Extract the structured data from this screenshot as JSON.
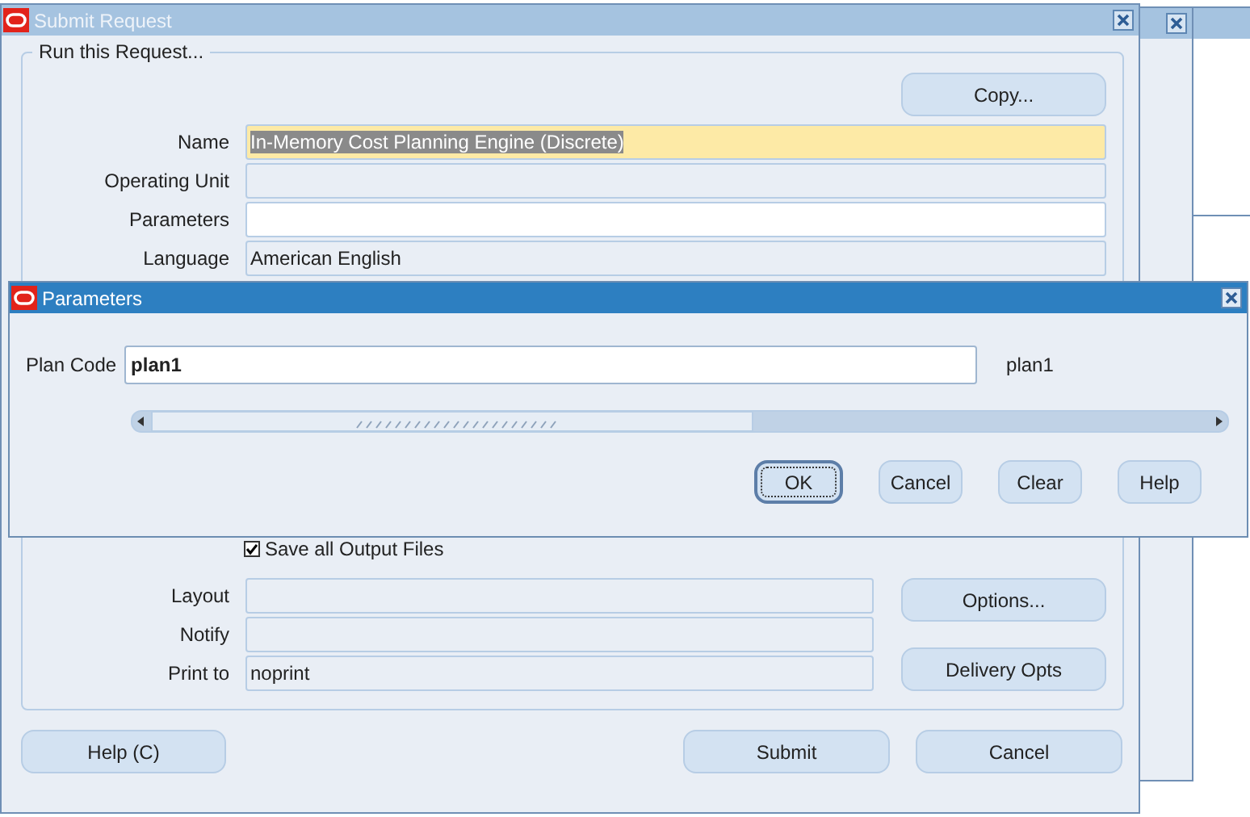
{
  "window": {
    "title": "Submit Request",
    "active": false
  },
  "group": {
    "title": "Run this Request..."
  },
  "copy_button": {
    "label": "Copy..."
  },
  "fields": [
    {
      "label": "Name",
      "value": "In-Memory Cost Planning Engine (Discrete)",
      "kind": "selected"
    },
    {
      "label": "Operating Unit",
      "kind": "readonly"
    },
    {
      "label": "Parameters",
      "kind": "editable"
    },
    {
      "label": "Language",
      "value": "American English",
      "kind": "readonly"
    }
  ],
  "save_output": {
    "label": "Save all Output Files",
    "checked": true
  },
  "delivery_fields": [
    {
      "label": "Layout",
      "kind": "readonly"
    },
    {
      "label": "Notify",
      "kind": "readonly"
    },
    {
      "label": "Print to",
      "value": "noprint",
      "kind": "readonly"
    }
  ],
  "side_buttons": [
    {
      "label": "Options..."
    },
    {
      "label": "Delivery Opts"
    }
  ],
  "help_button": {
    "label": "Help (C)"
  },
  "footer_buttons": [
    {
      "label": "Submit"
    },
    {
      "label": "Cancel"
    }
  ],
  "dialog": {
    "title": "Parameters",
    "active": true,
    "plan_code": {
      "label": "Plan Code",
      "value": "plan1",
      "description": "plan1"
    },
    "buttons": [
      {
        "label": "OK",
        "focused": true
      },
      {
        "label": "Cancel",
        "focused": false
      },
      {
        "label": "Clear",
        "focused": false
      },
      {
        "label": "Help",
        "focused": false
      }
    ]
  }
}
